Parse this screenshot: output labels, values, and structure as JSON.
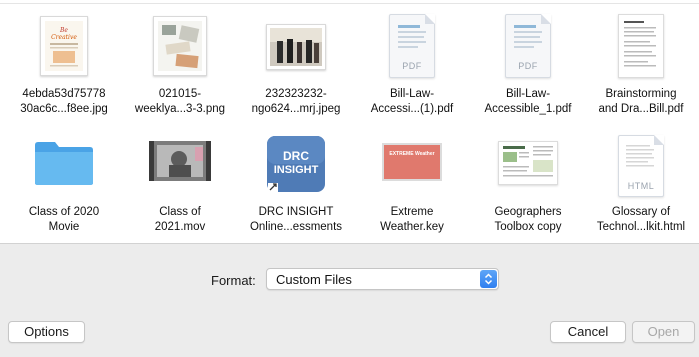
{
  "files": [
    {
      "line1": "4ebda53d75778",
      "line2": "30ac6c...f8ee.jpg",
      "kind": "photo-1"
    },
    {
      "line1": "021015-",
      "line2": "weeklya...3-3.png",
      "kind": "photo-2"
    },
    {
      "line1": "232323232-",
      "line2": "ngo624...mrj.jpeg",
      "kind": "photo-3"
    },
    {
      "line1": "Bill-Law-",
      "line2": "Accessi...(1).pdf",
      "kind": "pdf",
      "badge": "PDF"
    },
    {
      "line1": "Bill-Law-",
      "line2": "Accessible_1.pdf",
      "kind": "pdf",
      "badge": "PDF"
    },
    {
      "line1": "Brainstorming",
      "line2": "and Dra...Bill.pdf",
      "kind": "doc"
    },
    {
      "line1": "Class of 2020",
      "line2": "Movie",
      "kind": "folder"
    },
    {
      "line1": "Class of",
      "line2": "2021.mov",
      "kind": "video"
    },
    {
      "line1": "DRC INSIGHT",
      "line2": "Online...essments",
      "kind": "app",
      "app_text_1": "DRC",
      "app_text_2": "INSIGHT"
    },
    {
      "line1": "Extreme",
      "line2": "Weather.key",
      "kind": "keynote",
      "slide_title": "EXTREME Weather"
    },
    {
      "line1": "Geographers",
      "line2": "Toolbox copy",
      "kind": "doc2"
    },
    {
      "line1": "Glossary of",
      "line2": "Technol...lkit.html",
      "kind": "html",
      "badge": "HTML"
    }
  ],
  "format": {
    "label": "Format:",
    "value": "Custom Files"
  },
  "buttons": {
    "options": "Options",
    "cancel": "Cancel",
    "open": "Open"
  },
  "colors": {
    "accent": "#2f7ff0",
    "folder": "#5ab1ec",
    "app_blue": "#4d7ab8"
  }
}
